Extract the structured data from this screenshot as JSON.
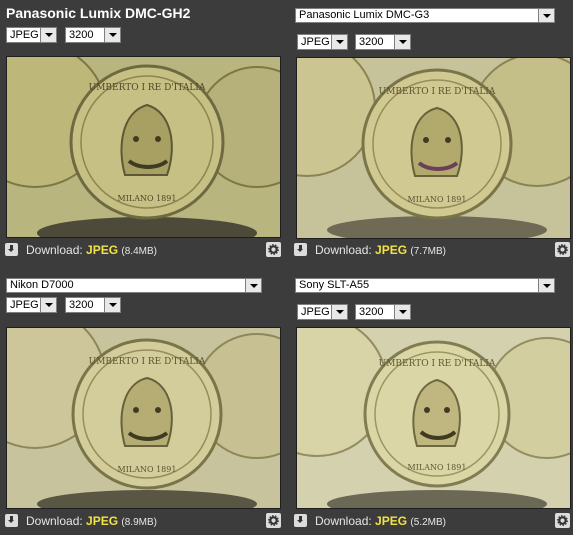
{
  "panels": [
    {
      "camera": "Panasonic Lumix DMC-GH2",
      "camera_control": "title",
      "format": "JPEG",
      "iso": "3200",
      "download_label": "Download:",
      "download_format": "JPEG",
      "download_size": "(8.4MB)"
    },
    {
      "camera": "Panasonic Lumix DMC-G3",
      "camera_control": "select",
      "format": "JPEG",
      "iso": "3200",
      "download_label": "Download:",
      "download_format": "JPEG",
      "download_size": "(7.7MB)"
    },
    {
      "camera": "Nikon D7000",
      "camera_control": "select",
      "format": "JPEG",
      "iso": "3200",
      "download_label": "Download:",
      "download_format": "JPEG",
      "download_size": "(8.9MB)"
    },
    {
      "camera": "Sony SLT-A55",
      "camera_control": "select",
      "format": "JPEG",
      "iso": "3200",
      "download_label": "Download:",
      "download_format": "JPEG",
      "download_size": "(5.2MB)"
    }
  ],
  "coin": {
    "legend": "UMBERTO I RE D'ITALIA",
    "mint": "MILANO 1891"
  },
  "icons": {
    "download": "download-icon",
    "settings": "gear-icon"
  },
  "colors": {
    "background": "#3c3c3c",
    "format_highlight": "#f2e340"
  }
}
